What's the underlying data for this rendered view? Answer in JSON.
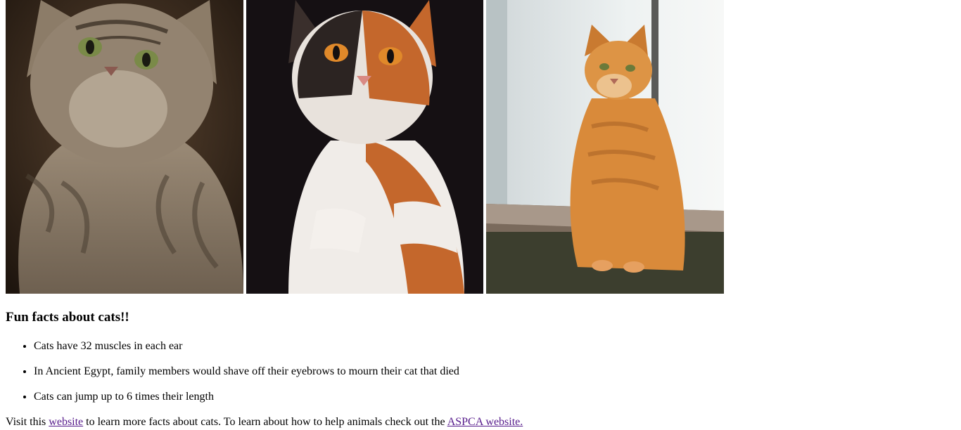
{
  "images": [
    {
      "icon": "tabby-cat-photo",
      "colors": {
        "bg": "#3a2a1c",
        "fur": "#8a7a68"
      }
    },
    {
      "icon": "calico-cat-photo",
      "colors": {
        "bg": "#171214",
        "fur": "#c46a2e"
      }
    },
    {
      "icon": "orange-cat-photo",
      "colors": {
        "bg": "#e9eef0",
        "fur": "#d98a3a"
      }
    }
  ],
  "facts": {
    "heading": "Fun facts about cats!!",
    "items": [
      "Cats have 32 muscles in each ear",
      "In Ancient Egypt, family members would shave off their eyebrows to mourn their cat that died",
      "Cats can jump up to 6 times their length"
    ]
  },
  "footer": {
    "text_before": "Visit this ",
    "link1": "website",
    "text_middle": " to learn more facts about cats. To learn about how to help animals check out the ",
    "link2": "ASPCA website.",
    "link_color": "#551a8b"
  }
}
